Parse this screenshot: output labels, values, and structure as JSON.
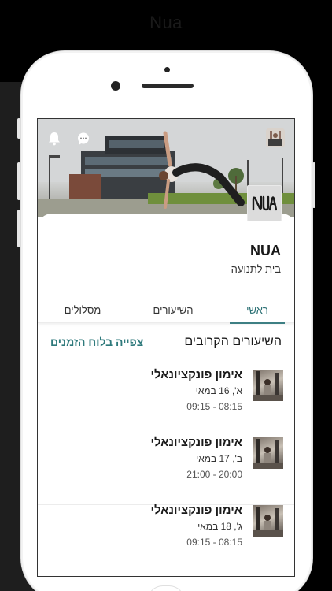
{
  "app_title": "Nua",
  "brand": {
    "name": "NUA",
    "subtitle": "בית לתנועה",
    "logo_text": "NUA"
  },
  "tabs": [
    {
      "label": "ראשי",
      "active": true
    },
    {
      "label": "השיעורים",
      "active": false
    },
    {
      "label": "מסלולים",
      "active": false
    }
  ],
  "upcoming": {
    "title": "השיעורים הקרובים",
    "view_schedule_label": "צפייה בלוח הזמנים",
    "classes": [
      {
        "name": "אימון פונקציונאלי",
        "date": "א', 16 במאי",
        "time": "09:15 - 08:15"
      },
      {
        "name": "אימון פונקציונאלי",
        "date": "ב', 17 במאי",
        "time": "21:00 - 20:00"
      },
      {
        "name": "אימון פונקציונאלי",
        "date": "ג', 18 במאי",
        "time": "09:15 - 08:15"
      }
    ]
  },
  "colors": {
    "accent": "#3d7f83",
    "link": "#2f7a7c"
  },
  "icons": {
    "bell": "bell-icon",
    "chat": "chat-icon",
    "avatar": "avatar-icon"
  }
}
